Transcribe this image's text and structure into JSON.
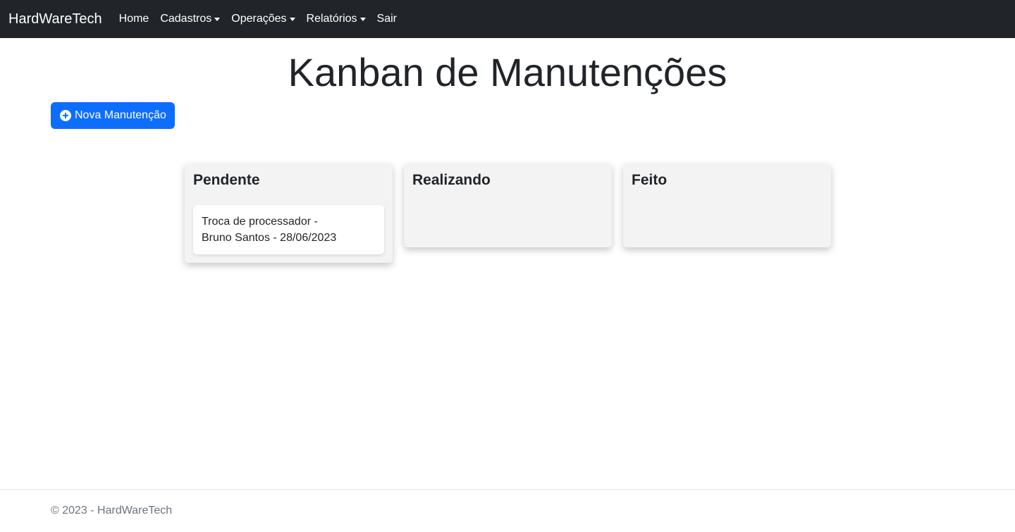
{
  "navbar": {
    "brand": "HardWareTech",
    "items": [
      {
        "label": "Home",
        "dropdown": false
      },
      {
        "label": "Cadastros",
        "dropdown": true
      },
      {
        "label": "Operações",
        "dropdown": true
      },
      {
        "label": "Relatórios",
        "dropdown": true
      },
      {
        "label": "Sair",
        "dropdown": false
      }
    ]
  },
  "page": {
    "title": "Kanban de Manutenções",
    "new_button_label": "Nova Manutenção",
    "new_button_icon": "plus-circle-icon"
  },
  "columns": [
    {
      "title": "Pendente",
      "cards": [
        {
          "line1": "Troca de processador -",
          "line2": "Bruno Santos - 28/06/2023"
        }
      ]
    },
    {
      "title": "Realizando",
      "cards": []
    },
    {
      "title": "Feito",
      "cards": []
    }
  ],
  "footer": {
    "text": "© 2023 - HardWareTech"
  },
  "colors": {
    "navbar_bg": "#212529",
    "primary": "#0d6efd",
    "column_bg": "#f3f3f3"
  }
}
